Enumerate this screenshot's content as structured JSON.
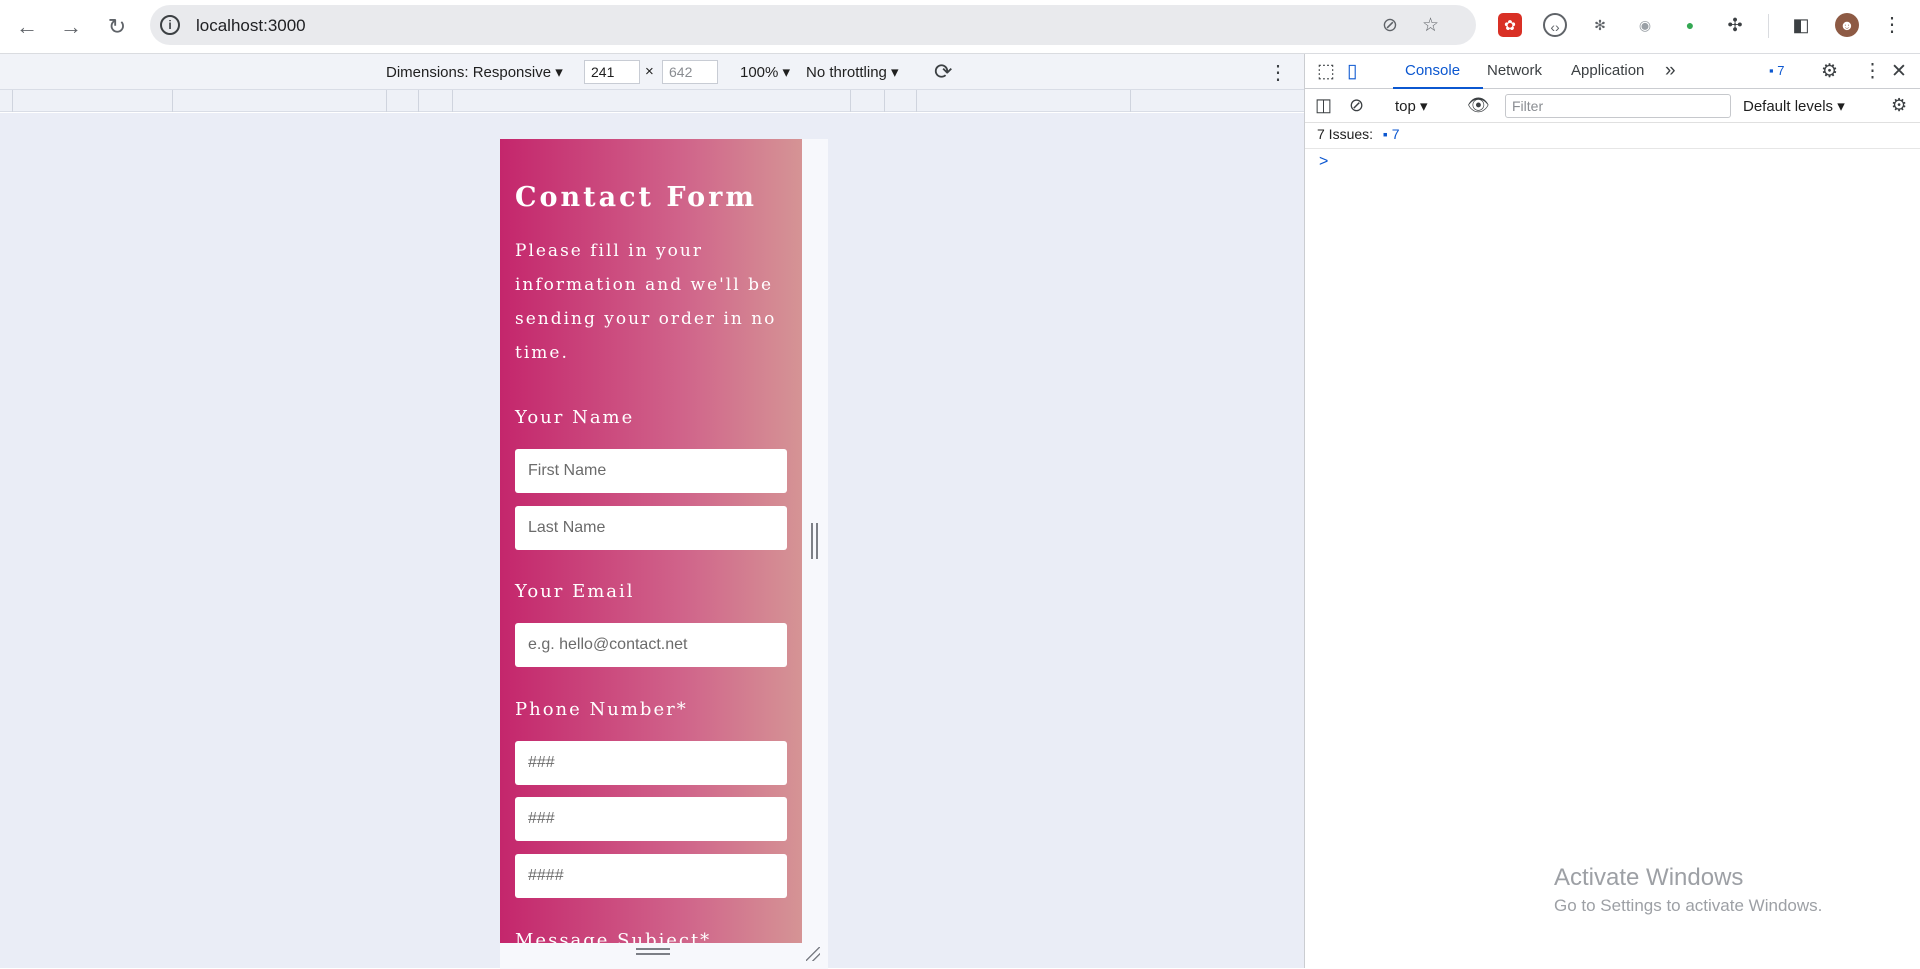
{
  "browser": {
    "url": "localhost:3000"
  },
  "device_toolbar": {
    "dimensions_label": "Dimensions: Responsive ▾",
    "width": "241",
    "height": "642",
    "times": "×",
    "zoom": "100% ▾",
    "throttling": "No throttling ▾"
  },
  "form": {
    "title": "Contact Form",
    "intro": "Please fill in your information and we'll be sending your order in no time.",
    "name_label": "Your Name",
    "first_name_placeholder": "First Name",
    "last_name_placeholder": "Last Name",
    "email_label": "Your Email",
    "email_placeholder": "e.g. hello@contact.net",
    "phone_label": "Phone Number*",
    "phone_part1_placeholder": "###",
    "phone_part2_placeholder": "###",
    "phone_part3_placeholder": "####",
    "subject_label": "Message Subject*"
  },
  "devtools": {
    "tabs": [
      "Console",
      "Network",
      "Application"
    ],
    "issues_badge": "7",
    "context": "top ▾",
    "filter_placeholder": "Filter",
    "levels": "Default levels ▾",
    "issues_text": "7 Issues:",
    "issues_count": "7",
    "prompt": ">"
  },
  "watermark": {
    "line1": "Activate Windows",
    "line2": "Go to Settings to activate Windows."
  },
  "colors": {
    "gradient_start": "#c4266c",
    "gradient_end": "#d59495",
    "accent_blue": "#0b57d0"
  }
}
